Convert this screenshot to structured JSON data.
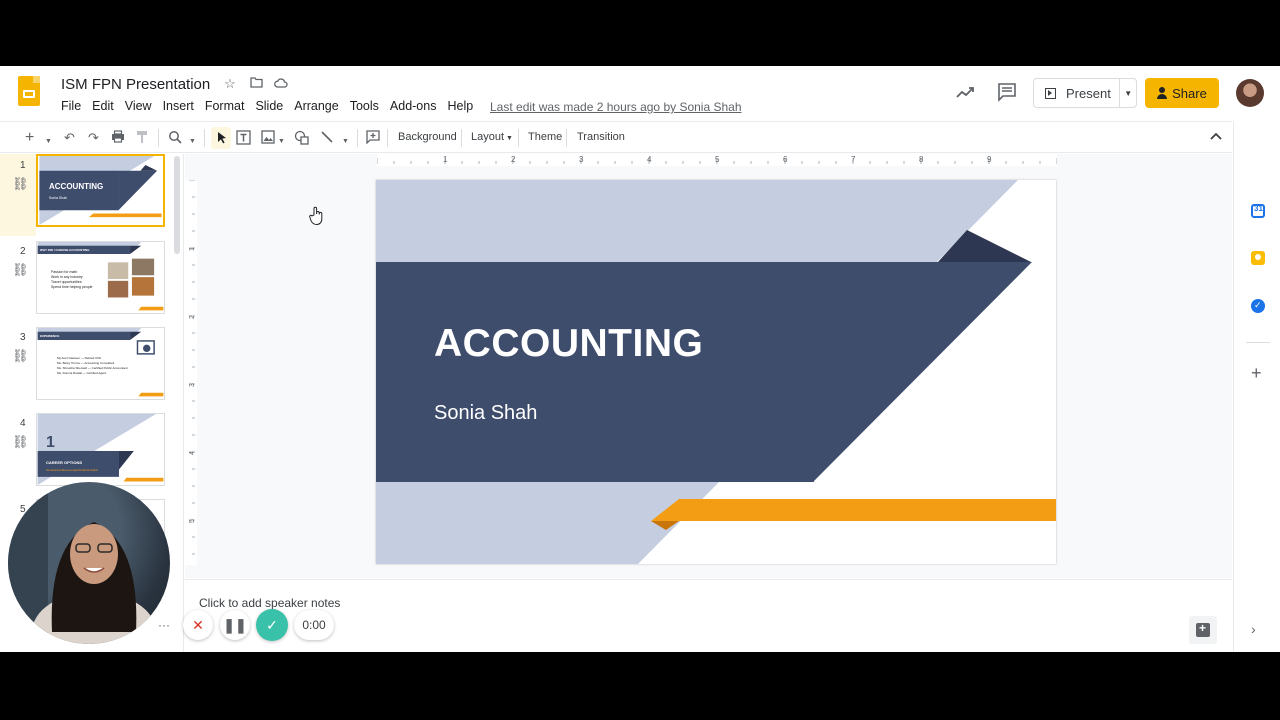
{
  "document": {
    "title": "ISM FPN Presentation",
    "last_edit": "Last edit was made 2 hours ago by Sonia Shah"
  },
  "menu": [
    "File",
    "Edit",
    "View",
    "Insert",
    "Format",
    "Slide",
    "Arrange",
    "Tools",
    "Add-ons",
    "Help"
  ],
  "header_actions": {
    "present_label": "Present",
    "share_label": "Share"
  },
  "toolbar": {
    "background_label": "Background",
    "layout_label": "Layout",
    "theme_label": "Theme",
    "transition_label": "Transition"
  },
  "ruler": {
    "horizontal": [
      "1",
      "2",
      "3",
      "4",
      "5",
      "6",
      "7",
      "8",
      "9"
    ],
    "vertical": [
      "1",
      "2",
      "3",
      "4",
      "5"
    ]
  },
  "filmstrip": {
    "slides": [
      {
        "number": "1",
        "title": "ACCOUNTING",
        "subtitle": "Sonia Shah"
      },
      {
        "number": "2",
        "header": "WHY DID I CHOOSE ACCOUNTING",
        "bullets": [
          "Passion for math",
          "Work in any industry",
          "Travel opportunities",
          "Spend time helping people"
        ]
      },
      {
        "number": "3",
        "header": "EXPERIENCE",
        "bullets": [
          "My Aunt Nasreen — Retired CPA",
          "Ms. Betsy Timms — Accounting Consultant",
          "Ms. Shrestha Sherwell — Certified Public Accountant",
          "Ms. Domna Roatal — Certified Agent"
        ]
      },
      {
        "number": "4",
        "big_number": "1",
        "title": "CAREER OPTIONS",
        "subtitle": "Tax Examiner/Revenue Agent/Collector/Auditor"
      },
      {
        "number": "5"
      }
    ]
  },
  "slide": {
    "title": "ACCOUNTING",
    "subtitle": "Sonia Shah"
  },
  "notes": {
    "placeholder": "Click to add speaker notes"
  },
  "recorder": {
    "timer": "0:00"
  },
  "colors": {
    "navy": "#3f4d6d",
    "light_blue": "#c5cee0",
    "dark_navy": "#2d3751",
    "orange": "#f29d13",
    "dark_orange": "#c8750a",
    "brand_yellow": "#f4b400"
  },
  "icons": {
    "logo": "slides-logo-icon",
    "star": "star-icon",
    "folder": "move-folder-icon",
    "cloud": "cloud-saved-icon",
    "activity": "activity-trend-icon",
    "comments": "comment-icon"
  }
}
